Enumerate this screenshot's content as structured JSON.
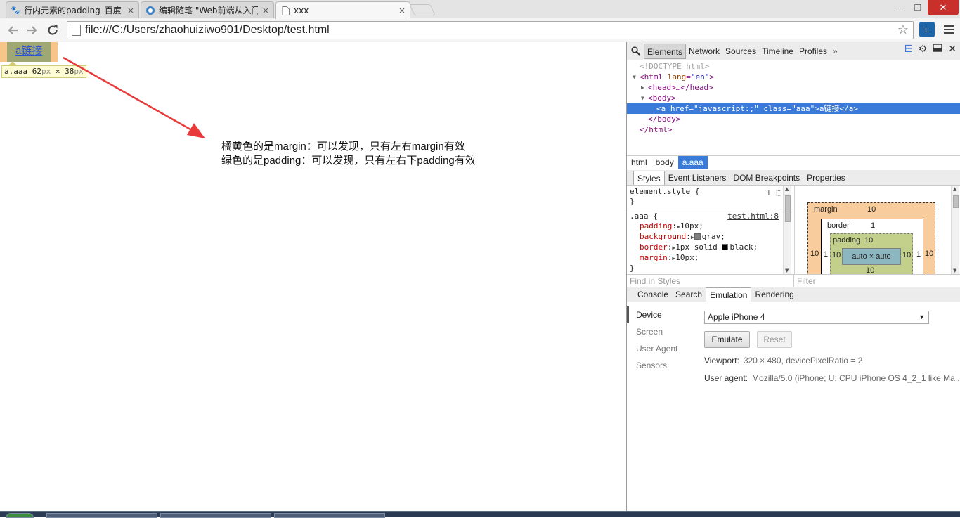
{
  "browser": {
    "tabs": [
      {
        "title": "行内元素的padding_百度",
        "favicon": "baidu-paw-icon",
        "active": false
      },
      {
        "title": "编辑随笔 \"Web前端从入门",
        "favicon": "cnblogs-icon",
        "active": false
      },
      {
        "title": "xxx",
        "favicon": "page-icon",
        "active": true
      }
    ],
    "tab_close_glyph": "×",
    "window_controls": {
      "minimize": "–",
      "restore": "❐",
      "close": "✕"
    },
    "address": "file:///C:/Users/zhaohuiziwo901/Desktop/test.html",
    "extension_label": "L"
  },
  "page": {
    "link_text": "a链接",
    "tooltip_selector": "a.aaa",
    "tooltip_w": "62",
    "tooltip_h": "38",
    "tooltip_unit": "px",
    "tooltip_times": "×",
    "notes": [
      "橘黄色的是margin：可以发现，只有左右margin有效",
      "绿色的是padding：可以发现，只有左右下padding有效"
    ],
    "annotation_color": "#e83a3a"
  },
  "devtools": {
    "tabs": [
      "Elements",
      "Network",
      "Sources",
      "Timeline",
      "Profiles"
    ],
    "more_glyph": "»",
    "dom": {
      "doctype": "<!DOCTYPE html>",
      "html_open_tag": "<html",
      "html_lang_attr": "lang",
      "html_lang_val": "\"en\"",
      "html_open_end": ">",
      "head": "<head>…</head>",
      "body_open": "<body>",
      "a_tag_open": "<a",
      "a_href_attr": "href",
      "a_href_val": "\"javascript:;\"",
      "a_class_attr": "class",
      "a_class_val": "\"aaa\"",
      "a_close_bracket": ">",
      "a_text": "a链接",
      "a_end": "</a>",
      "body_close": "</body>",
      "html_close": "</html>"
    },
    "breadcrumbs": [
      "html",
      "body",
      "a.aaa"
    ],
    "sidebar_tabs": [
      "Styles",
      "Event Listeners",
      "DOM Breakpoints",
      "Properties"
    ],
    "styles": {
      "element_style": "element.style {",
      "close_brace": "}",
      "rule_selector": ".aaa {",
      "rule_source": "test.html:8",
      "props": [
        {
          "name": "padding",
          "value": "10px;",
          "swatch": ""
        },
        {
          "name": "background",
          "value": "gray;",
          "swatch": "#808080"
        },
        {
          "name": "border",
          "value": "1px solid ",
          "value2": "black;",
          "swatch": "#000000"
        },
        {
          "name": "margin",
          "value": "10px;",
          "swatch": ""
        }
      ]
    },
    "box_model": {
      "margin_label": "margin",
      "margin_top": "10",
      "margin_left": "10",
      "margin_right": "10",
      "border_label": "border",
      "border_top": "1",
      "border_left": "1",
      "border_right": "1",
      "padding_label": "padding",
      "padding_top": "10",
      "padding_left": "10",
      "padding_right": "10",
      "padding_bottom": "10",
      "content": "auto × auto"
    },
    "find_in_styles_placeholder": "Find in Styles",
    "filter_placeholder": "Filter",
    "drawer_tabs": [
      "Console",
      "Search",
      "Emulation",
      "Rendering"
    ],
    "emulation": {
      "nav": [
        "Device",
        "Screen",
        "User Agent",
        "Sensors"
      ],
      "device_selected": "Apple iPhone 4",
      "emulate_label": "Emulate",
      "reset_label": "Reset",
      "viewport_key": "Viewport:",
      "viewport_value": "320 × 480, devicePixelRatio = 2",
      "ua_key": "User agent:",
      "ua_value": "Mozilla/5.0 (iPhone; U; CPU iPhone OS 4_2_1 like Ma..."
    }
  }
}
